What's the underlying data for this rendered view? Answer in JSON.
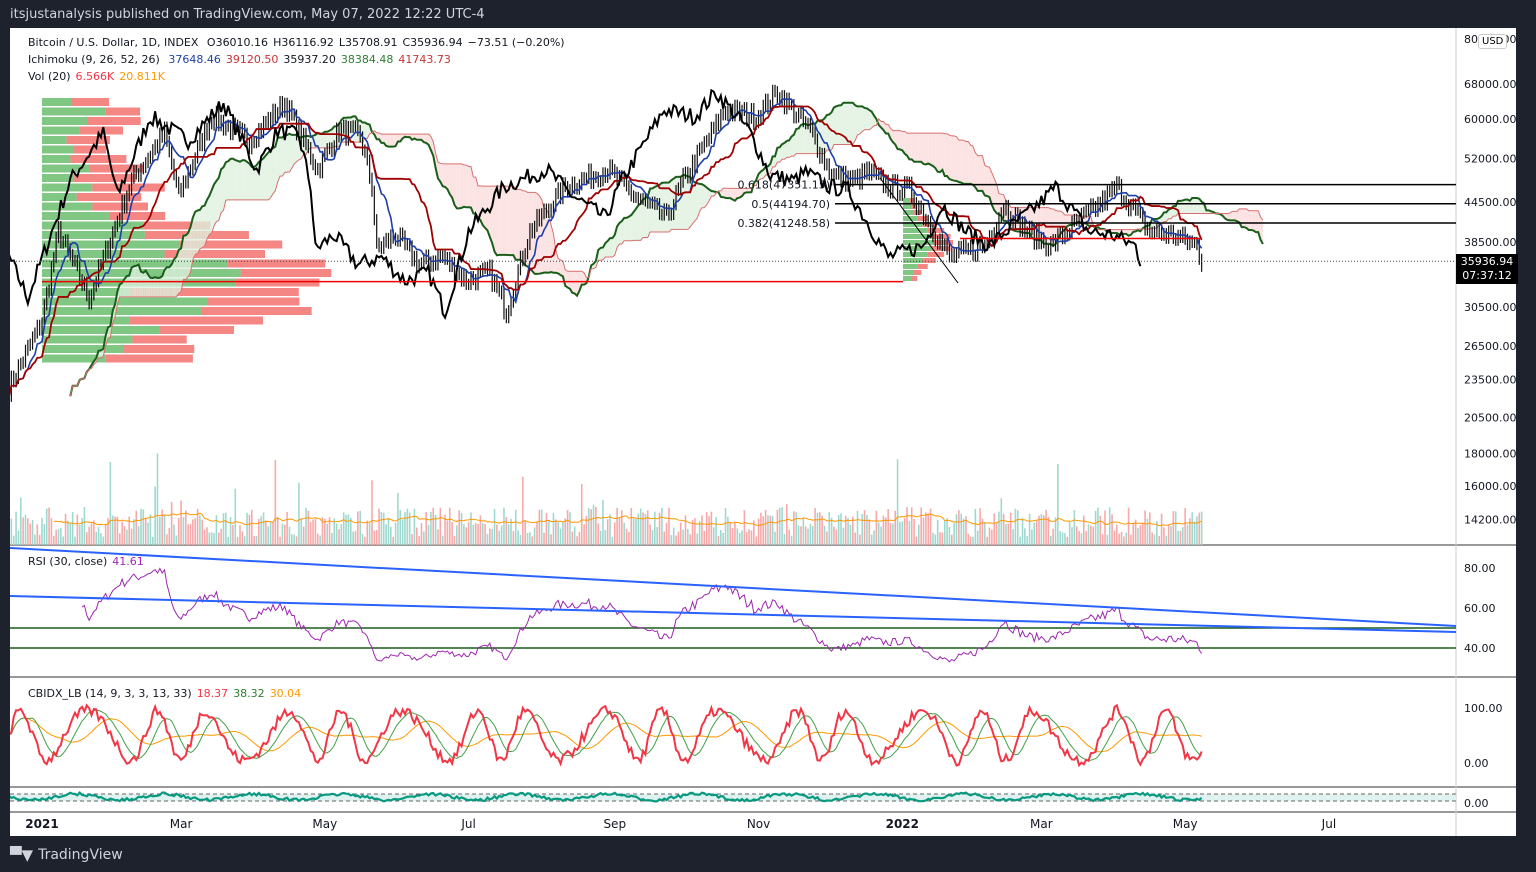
{
  "header": {
    "published": "itsjustanalysis published on TradingView.com, May 07, 2022 12:22 UTC-4"
  },
  "legend": {
    "symbol": "Bitcoin / U.S. Dollar, 1D, INDEX",
    "open": "O36010.16",
    "high": "H36116.92",
    "low": "L35708.91",
    "close": "C35936.94",
    "change": "−73.51 (−0.20%)",
    "ichimoku": "Ichimoku (9, 26, 52, 26)",
    "ich_vals": [
      "37648.46",
      "39120.50",
      "35937.20",
      "38384.48",
      "41743.73"
    ],
    "vol": "Vol (20)",
    "vol_vals": [
      "6.566K",
      "20.811K"
    ],
    "rsi": "RSI (30, close)",
    "rsi_val": "41.61",
    "cbidx": "CBIDX_LB (14, 9, 3, 3, 13, 33)",
    "cbidx_vals": [
      "18.37",
      "38.32",
      "30.04"
    ]
  },
  "currency": "USD",
  "current_price": {
    "price": "35936.94",
    "countdown": "07:37:12"
  },
  "brand": "TradingView",
  "colors": {
    "tenkan": "#1e3fa8",
    "kijun": "#a00000",
    "spanA": "#1a5e1a",
    "spanB": "#c83232",
    "chikou": "#000000",
    "rsi": "#9c27b0",
    "trend": "#2962ff",
    "cb_fast": "#f23645",
    "cb_mid": "#43a047",
    "cb_slow": "#ff9800",
    "bottom": "#089981"
  },
  "chart_data": {
    "type": "line",
    "title": "Bitcoin / U.S. Dollar, 1D, INDEX",
    "price_ticks": [
      80000,
      68000,
      60000,
      52000,
      44500,
      38500,
      30500,
      26500,
      23500,
      20500,
      18000,
      16000,
      14200
    ],
    "date_ticks": [
      {
        "label": "2021",
        "day": 0
      },
      {
        "label": "Mar",
        "day": 59
      },
      {
        "label": "May",
        "day": 120
      },
      {
        "label": "Jul",
        "day": 181
      },
      {
        "label": "Sep",
        "day": 243
      },
      {
        "label": "Nov",
        "day": 304
      },
      {
        "label": "2022",
        "day": 365
      },
      {
        "label": "Mar",
        "day": 424
      },
      {
        "label": "May",
        "day": 485
      },
      {
        "label": "Jul",
        "day": 546
      }
    ],
    "close_keypoints": [
      [
        -14,
        22800
      ],
      [
        0,
        29000
      ],
      [
        7,
        40000
      ],
      [
        20,
        31500
      ],
      [
        38,
        48000
      ],
      [
        52,
        57000
      ],
      [
        58,
        45500
      ],
      [
        72,
        60500
      ],
      [
        88,
        55500
      ],
      [
        103,
        63500
      ],
      [
        117,
        50000
      ],
      [
        126,
        57500
      ],
      [
        135,
        56500
      ],
      [
        140,
        47000
      ],
      [
        142,
        37500
      ],
      [
        150,
        39500
      ],
      [
        160,
        35500
      ],
      [
        170,
        36500
      ],
      [
        180,
        33500
      ],
      [
        190,
        34500
      ],
      [
        197,
        30000
      ],
      [
        207,
        40000
      ],
      [
        222,
        47000
      ],
      [
        240,
        50000
      ],
      [
        251,
        45500
      ],
      [
        265,
        42000
      ],
      [
        272,
        48000
      ],
      [
        290,
        62000
      ],
      [
        303,
        60500
      ],
      [
        312,
        66000
      ],
      [
        326,
        57500
      ],
      [
        335,
        49000
      ],
      [
        345,
        48000
      ],
      [
        350,
        49500
      ],
      [
        360,
        47000
      ],
      [
        368,
        46500
      ],
      [
        385,
        36500
      ],
      [
        400,
        38000
      ],
      [
        408,
        44000
      ],
      [
        418,
        40000
      ],
      [
        428,
        38000
      ],
      [
        440,
        41500
      ],
      [
        450,
        44500
      ],
      [
        456,
        47000
      ],
      [
        470,
        40000
      ],
      [
        480,
        39500
      ],
      [
        490,
        38000
      ],
      [
        492,
        35937
      ]
    ],
    "fib_levels": [
      {
        "label": "0.618(47351.15)",
        "price": 47351.15
      },
      {
        "label": "0.5(44194.70)",
        "price": 44194.7
      },
      {
        "label": "0.382(41248.58)",
        "price": 41248.58
      }
    ],
    "support_line": 33400,
    "rsi_ticks": [
      80,
      60,
      40
    ],
    "rsi_levels": [
      50,
      40
    ],
    "cbidx_ticks": [
      100,
      0
    ],
    "bottom_ticks": [
      0
    ]
  }
}
